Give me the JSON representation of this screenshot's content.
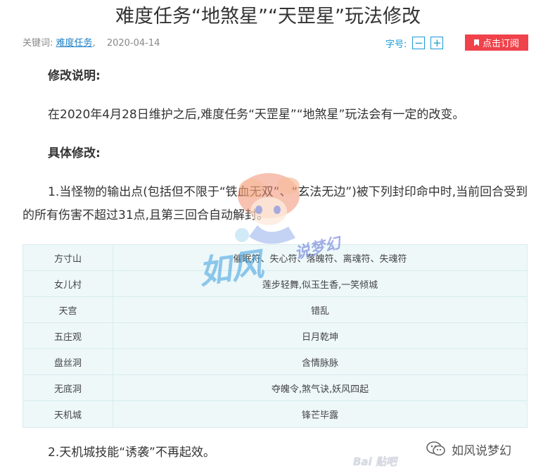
{
  "article": {
    "title": "难度任务“地煞星”“天罡星”玩法修改",
    "meta": {
      "keyword_label": "关键词:",
      "keyword": "难度任务",
      "keyword_sep": ",",
      "date": "2020-04-14"
    }
  },
  "toolbar": {
    "font_size_label": "字号:",
    "decrease": "−",
    "increase": "+",
    "subscribe_label": "点击订阅"
  },
  "content": {
    "heading1": "修改说明:",
    "para1": "在2020年4月28日维护之后,难度任务“天罡星”“地煞星”玩法会有一定的改变。",
    "heading2": "具体修改:",
    "para2": "1.当怪物的输出点(包括但不限于“铁血无双”、“玄法无边”)被下列封印命中时,当前回合受到的所有伤害不超过31点,且第三回合自动解封。",
    "table": [
      {
        "sect": "方寸山",
        "seals": "催眠符、失心符、落魄符、离魂符、失魂符"
      },
      {
        "sect": "女儿村",
        "seals": "莲步轻舞,似玉生香,一笑倾城"
      },
      {
        "sect": "天宫",
        "seals": "错乱"
      },
      {
        "sect": "五庄观",
        "seals": "日月乾坤"
      },
      {
        "sect": "盘丝洞",
        "seals": "含情脉脉"
      },
      {
        "sect": "无底洞",
        "seals": "夺魄令,煞气诀,妖风四起"
      },
      {
        "sect": "天机城",
        "seals": "锋芒毕露"
      }
    ],
    "para3": "2.天机城技能“诱袭”不再起效。"
  },
  "watermarks": {
    "mascot_big": "如风",
    "mascot_small": "说梦幻",
    "wechat_account": "如风说梦幻",
    "baidu": "Bai 贴吧"
  },
  "colors": {
    "link": "#1a7fc4",
    "accent": "#1a9ad6",
    "subscribe_bg": "#f0424b",
    "table_bg": "#eef8f9",
    "table_border": "#d8ebef"
  }
}
